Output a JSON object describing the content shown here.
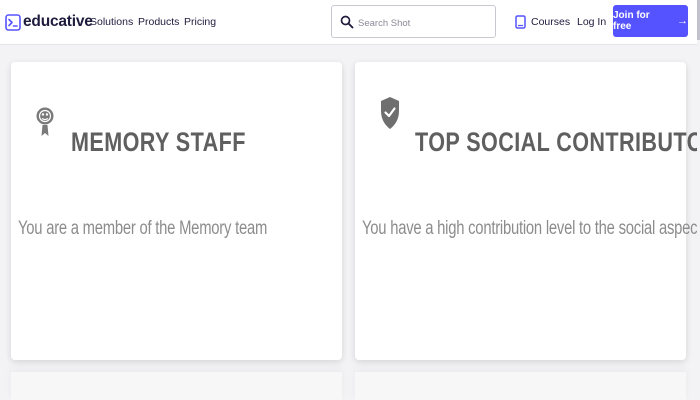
{
  "header": {
    "brand": "educative",
    "nav": [
      "Solutions",
      "Products",
      "Pricing"
    ],
    "search_placeholder": "Search Shot",
    "courses": "Courses",
    "login": "Log In",
    "join": "Join for free",
    "join_arrow": "→",
    "accent_color": "#5553ff"
  },
  "badges": [
    {
      "icon": "memory-badge-icon",
      "title": "MEMORY STAFF",
      "description": "You are a member of the Memory team"
    },
    {
      "icon": "shield-check-icon",
      "title": "TOP SOCIAL CONTRIBUTOR",
      "description": "You have a high contribution level to the social aspects"
    }
  ]
}
